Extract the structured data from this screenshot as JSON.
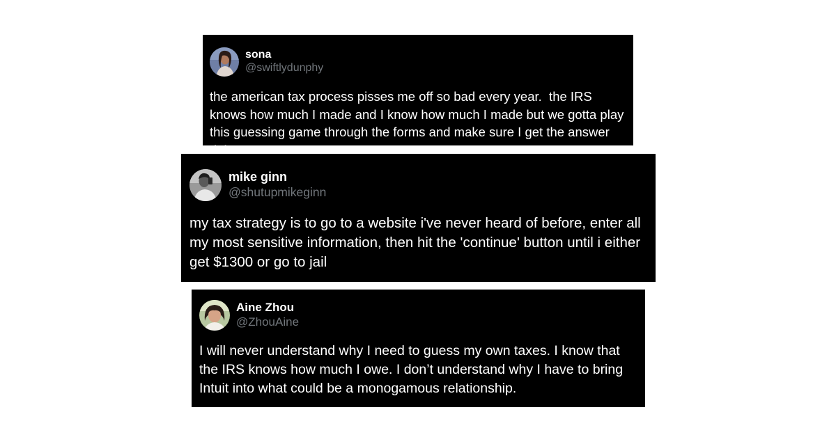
{
  "tweets": [
    {
      "display_name": "sona",
      "handle": "@swiftlydunphy",
      "avatar": "user-avatar",
      "text": "the american tax process pisses me off so bad every year.  the IRS knows how much I made and I know how much I made but we gotta play this guessing game through the forms and make sure I get the answer right"
    },
    {
      "display_name": "mike ginn",
      "handle": "@shutupmikeginn",
      "avatar": "user-avatar",
      "text": "my tax strategy is to go to a website i've never heard of before, enter all my most sensitive information, then hit the 'continue' button until i either get $1300 or go to jail"
    },
    {
      "display_name": "Aine Zhou",
      "handle": "@ZhouAine",
      "avatar": "user-avatar",
      "text": "I will never understand why I need to guess my own taxes. I know that the IRS knows how much I owe. I don’t understand why I have to bring Intuit into what could be a monogamous relationship."
    }
  ],
  "colors": {
    "card_background": "#000000",
    "text": "#ffffff",
    "handle": "#71767b",
    "page_background": "#ffffff"
  }
}
